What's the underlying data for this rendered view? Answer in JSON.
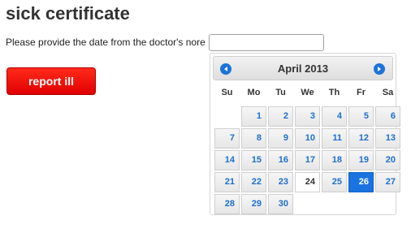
{
  "page": {
    "title": "sick certificate",
    "prompt": "Please provide the date from the doctor's nore",
    "date_value": "",
    "report_button": "report ill"
  },
  "datepicker": {
    "month_label": "April 2013",
    "prev_icon": "prev-arrow",
    "next_icon": "next-arrow",
    "weekdays": [
      "Su",
      "Mo",
      "Tu",
      "We",
      "Th",
      "Fr",
      "Sa"
    ],
    "weeks": [
      [
        "",
        "1",
        "2",
        "3",
        "4",
        "5",
        "6"
      ],
      [
        "7",
        "8",
        "9",
        "10",
        "11",
        "12",
        "13"
      ],
      [
        "14",
        "15",
        "16",
        "17",
        "18",
        "19",
        "20"
      ],
      [
        "21",
        "22",
        "23",
        "24",
        "25",
        "26",
        "27"
      ],
      [
        "28",
        "29",
        "30",
        "",
        "",
        "",
        ""
      ]
    ],
    "today": "24",
    "selected": "26",
    "colors": {
      "accent": "#1a73e0",
      "button": "#e60000"
    }
  }
}
